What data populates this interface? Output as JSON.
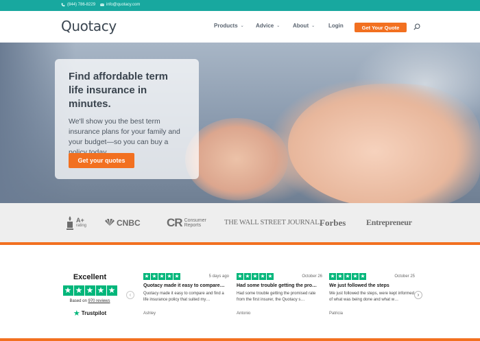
{
  "topbar": {
    "phone": "(844) 786-8229",
    "email": "info@quotacy.com"
  },
  "header": {
    "logo": "Quotacy",
    "nav": [
      {
        "label": "Products",
        "has_dropdown": true
      },
      {
        "label": "Advice",
        "has_dropdown": true
      },
      {
        "label": "About",
        "has_dropdown": true
      },
      {
        "label": "Login",
        "has_dropdown": false
      }
    ],
    "cta": "Get Your Quote",
    "search_icon": "search-icon"
  },
  "hero": {
    "headline": "Find affordable term life insurance in minutes.",
    "subtext": "We'll show you the best term insurance plans for your family and your budget—so you can buy a policy today.",
    "button": "Get your quotes"
  },
  "press": {
    "bbb": {
      "grade": "A+",
      "word": "rating"
    },
    "cnbc": "CNBC",
    "cr": {
      "mark": "CR",
      "line1": "Consumer",
      "line2": "Reports"
    },
    "wsj": "THE WALL STREET JOURNAL.",
    "forbes": "Forbes",
    "entrepreneur": "Entrepreneur"
  },
  "trustpilot": {
    "rating_word": "Excellent",
    "based_prefix": "Based on ",
    "review_count": "970 reviews",
    "brand": "Trustpilot"
  },
  "reviews": [
    {
      "stars": 5,
      "date": "5 days ago",
      "title": "Quotacy made it easy to compare…",
      "body": "Quotacy made it easy to compare and find a life insurance policy that suited my…",
      "author": "Ashley"
    },
    {
      "stars": 5,
      "date": "October 26",
      "title": "Had some trouble getting the pro…",
      "body": "Had some trouble getting the promised rate from the first insurer, the Quotacy s…",
      "author": "Antonio"
    },
    {
      "stars": 5,
      "date": "October 25",
      "title": "We just followed the steps",
      "body": "We just followed the steps, were kept informed of what was being done and what w…",
      "author": "Patricia"
    }
  ],
  "colors": {
    "teal": "#18a89f",
    "orange": "#f27020",
    "trustpilot_green": "#00b67a"
  }
}
